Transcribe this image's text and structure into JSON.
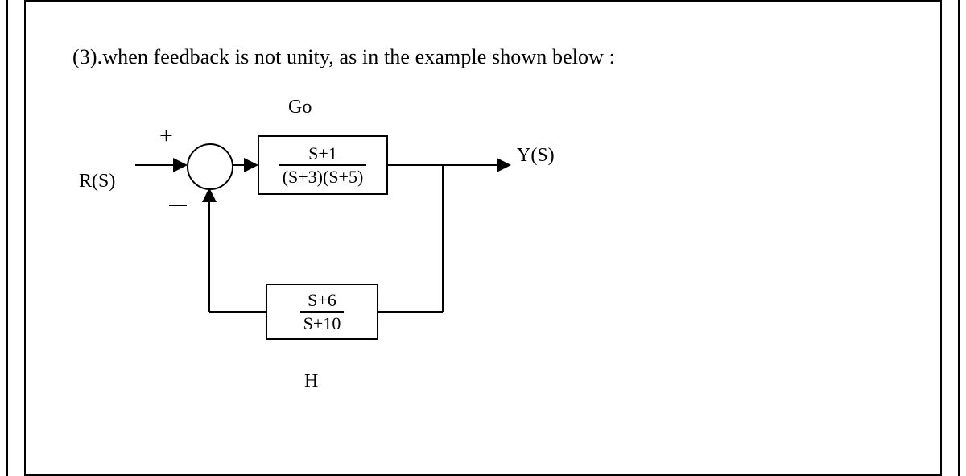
{
  "prompt": "(3).when feedback is not unity, as in the example shown below :",
  "labels": {
    "input": "R(S)",
    "output": "Y(S)",
    "forward_gain": "Go",
    "feedback_gain": "H",
    "sum_plus": "+",
    "sum_minus": "−"
  },
  "blocks": {
    "forward": {
      "numerator": "S+1",
      "denominator": "(S+3)(S+5)"
    },
    "feedback": {
      "numerator": "S+6",
      "denominator": "S+10"
    }
  }
}
